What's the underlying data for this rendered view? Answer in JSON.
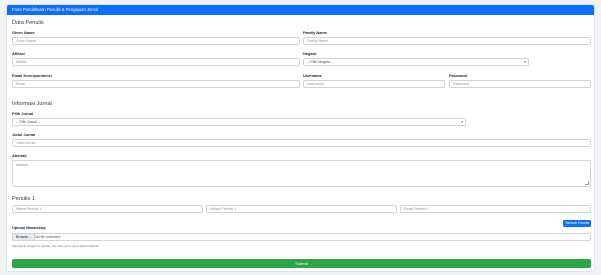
{
  "header": {
    "title": "Form Pendaftaran Penulis & Pengajuan Jurnal"
  },
  "sections": {
    "penulis": "Data Penulis",
    "jurnal": "Informasi Jurnal",
    "penulis1": "Penulis 1"
  },
  "fields": {
    "given_name": {
      "label": "Given Name",
      "placeholder": "Given Name"
    },
    "family_name": {
      "label": "Family Name",
      "placeholder": "Family Name"
    },
    "afiliasi": {
      "label": "Afiliasi",
      "placeholder": "Afiliasi"
    },
    "negara": {
      "label": "Negara",
      "value": "-- Pilih Negara --"
    },
    "email": {
      "label": "Email Korespondensi",
      "placeholder": "Email"
    },
    "username": {
      "label": "Username",
      "placeholder": "Username"
    },
    "password": {
      "label": "Password",
      "placeholder": "Password"
    },
    "pilih_jurnal": {
      "label": "Pilih Jurnal",
      "value": "-- Pilih Jurnal --"
    },
    "judul": {
      "label": "Judul Jurnal",
      "placeholder": "Judul Jurnal"
    },
    "abstrak": {
      "label": "Abstrak",
      "placeholder": "Abstrak"
    }
  },
  "penulis1": {
    "nama": "Nama Penulis 1",
    "afiliasi": "Afiliasi Penulis 1",
    "email": "Email Penulis 1",
    "add_button": "Tambah Penulis"
  },
  "upload": {
    "label": "Upload Manuskrip",
    "browse": "Browse...",
    "file_status": "No file selected.",
    "help": "Manuskrip dengan template, doc atau docx yang diperbolehkan"
  },
  "submit": "Submit",
  "colors": {
    "primary": "#0d6efd",
    "success": "#28a745"
  }
}
